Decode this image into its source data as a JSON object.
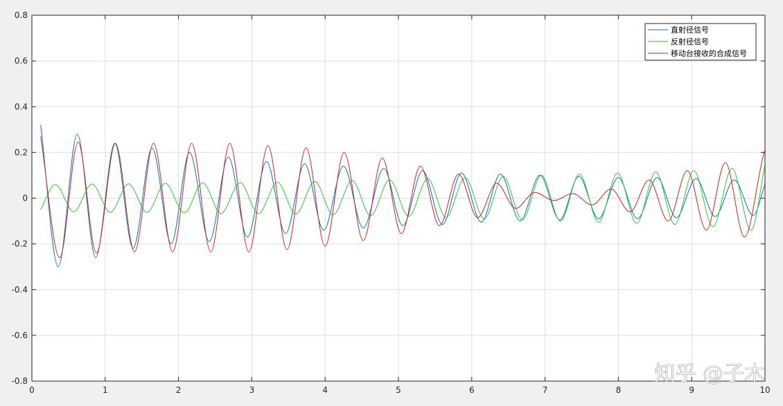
{
  "chart_data": {
    "type": "line",
    "xlim": [
      0,
      10
    ],
    "ylim": [
      -0.8,
      0.8
    ],
    "xticks": [
      0,
      1,
      2,
      3,
      4,
      5,
      6,
      7,
      8,
      9,
      10
    ],
    "yticks": [
      -0.8,
      -0.6,
      -0.4,
      -0.2,
      0,
      0.2,
      0.4,
      0.6,
      0.8
    ],
    "grid": true,
    "legend_position": "top-right",
    "series": [
      {
        "name": "直射径信号",
        "color": "#0072BD",
        "x": [
          0.12,
          0.36,
          0.62,
          0.87,
          1.13,
          1.38,
          1.64,
          1.9,
          2.15,
          2.42,
          2.68,
          2.94,
          3.2,
          3.46,
          3.72,
          3.98,
          4.25,
          4.52,
          4.8,
          5.06,
          5.33,
          5.6,
          5.86,
          6.13,
          6.39,
          6.66,
          6.93,
          7.2,
          7.46,
          7.73,
          8.0,
          8.26,
          8.53,
          8.79,
          9.06,
          9.32,
          9.58,
          9.84,
          10.0
        ],
        "y": [
          0.32,
          -0.3,
          0.28,
          -0.26,
          0.24,
          -0.22,
          0.22,
          -0.2,
          0.2,
          -0.19,
          0.18,
          -0.17,
          0.16,
          -0.155,
          0.15,
          -0.14,
          0.14,
          -0.13,
          0.13,
          -0.12,
          0.12,
          -0.115,
          0.11,
          -0.105,
          0.105,
          -0.1,
          0.1,
          -0.095,
          0.095,
          -0.09,
          0.09,
          -0.09,
          0.09,
          -0.085,
          0.085,
          -0.08,
          0.08,
          -0.075,
          0.06
        ]
      },
      {
        "name": "反射径信号",
        "color": "#2DC72D",
        "x": [
          0.12,
          0.32,
          0.57,
          0.82,
          1.07,
          1.32,
          1.57,
          1.82,
          2.08,
          2.33,
          2.58,
          2.84,
          3.09,
          3.35,
          3.6,
          3.86,
          4.11,
          4.37,
          4.62,
          4.88,
          5.14,
          5.4,
          5.65,
          5.91,
          6.17,
          6.43,
          6.69,
          6.95,
          7.21,
          7.47,
          7.73,
          7.99,
          8.25,
          8.51,
          8.77,
          9.03,
          9.29,
          9.55,
          9.81,
          10.0
        ],
        "y": [
          -0.05,
          0.06,
          -0.06,
          0.062,
          -0.062,
          0.063,
          -0.063,
          0.065,
          -0.065,
          0.067,
          -0.067,
          0.068,
          -0.068,
          0.07,
          -0.07,
          0.073,
          -0.073,
          0.077,
          -0.077,
          0.08,
          -0.08,
          0.085,
          -0.085,
          0.09,
          -0.09,
          0.095,
          -0.095,
          0.1,
          -0.1,
          0.105,
          -0.105,
          0.11,
          -0.11,
          0.115,
          -0.115,
          0.12,
          -0.125,
          0.13,
          -0.14,
          0.145
        ]
      },
      {
        "name": "移动台接收的合成信号",
        "color": "#D21F1F",
        "x": [
          0.12,
          0.38,
          0.63,
          0.88,
          1.14,
          1.4,
          1.66,
          1.92,
          2.18,
          2.44,
          2.7,
          2.96,
          3.22,
          3.48,
          3.74,
          4.0,
          4.26,
          4.52,
          4.78,
          5.04,
          5.3,
          5.56,
          5.82,
          6.08,
          6.34,
          6.6,
          6.86,
          7.12,
          7.38,
          7.64,
          7.9,
          8.16,
          8.42,
          8.68,
          8.94,
          9.2,
          9.46,
          9.72,
          9.98,
          10.0
        ],
        "y": [
          0.27,
          -0.26,
          0.245,
          -0.24,
          0.24,
          -0.235,
          0.24,
          -0.235,
          0.24,
          -0.235,
          0.24,
          -0.235,
          0.23,
          -0.225,
          0.22,
          -0.21,
          0.2,
          -0.185,
          0.175,
          -0.155,
          0.14,
          -0.12,
          0.105,
          -0.085,
          0.065,
          -0.045,
          0.025,
          -0.01,
          0.02,
          -0.03,
          0.04,
          -0.06,
          0.08,
          -0.1,
          0.12,
          -0.14,
          0.155,
          -0.17,
          0.19,
          0.21
        ]
      }
    ]
  },
  "watermark": "知乎 @子木"
}
